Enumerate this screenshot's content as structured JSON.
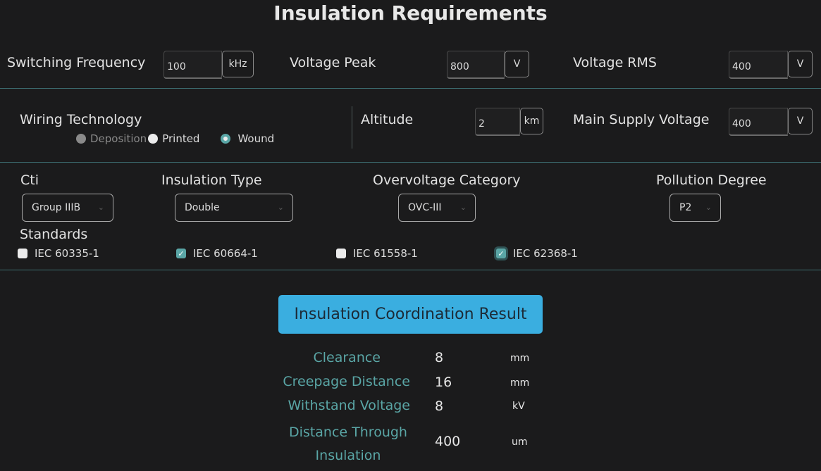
{
  "title": "Insulation Requirements",
  "row1": {
    "switching_frequency": {
      "label": "Switching Frequency",
      "value": "100",
      "unit": "kHz"
    },
    "voltage_peak": {
      "label": "Voltage Peak",
      "value": "800",
      "unit": "V"
    },
    "voltage_rms": {
      "label": "Voltage RMS",
      "value": "400",
      "unit": "V"
    }
  },
  "row2": {
    "wiring": {
      "label": "Wiring Technology",
      "options": [
        "Deposition",
        "Printed",
        "Wound"
      ],
      "selected": "Wound",
      "disabled": [
        "Deposition"
      ]
    },
    "altitude": {
      "label": "Altitude",
      "value": "2",
      "unit": "km"
    },
    "main_supply": {
      "label": "Main Supply Voltage",
      "value": "400",
      "unit": "V"
    }
  },
  "row3": {
    "cti": {
      "label": "Cti",
      "selected": "Group IIIB"
    },
    "insulation_type": {
      "label": "Insulation Type",
      "selected": "Double"
    },
    "overvoltage": {
      "label": "Overvoltage Category",
      "selected": "OVC-III"
    },
    "pollution": {
      "label": "Pollution Degree",
      "selected": "P2"
    }
  },
  "standards": {
    "label": "Standards",
    "items": [
      {
        "label": "IEC 60335-1",
        "checked": false
      },
      {
        "label": "IEC 60664-1",
        "checked": true
      },
      {
        "label": "IEC 61558-1",
        "checked": false
      },
      {
        "label": "IEC 62368-1",
        "checked": true
      }
    ]
  },
  "result": {
    "button_label": "Insulation Coordination Result",
    "rows": [
      {
        "label": "Clearance",
        "value": "8",
        "unit": "mm"
      },
      {
        "label": "Creepage Distance",
        "value": "16",
        "unit": "mm"
      },
      {
        "label": "Withstand Voltage",
        "value": "8",
        "unit": "kV"
      },
      {
        "label_line1": "Distance Through",
        "label_line2": "Insulation",
        "value": "400",
        "unit": "um"
      }
    ]
  },
  "colors": {
    "accent": "#5aa6a6",
    "button": "#3aaee0",
    "background": "#1b1b1c",
    "divider": "#3d6f72"
  },
  "icons": {
    "dropdown": "chevron-down-icon",
    "check": "check-icon"
  }
}
